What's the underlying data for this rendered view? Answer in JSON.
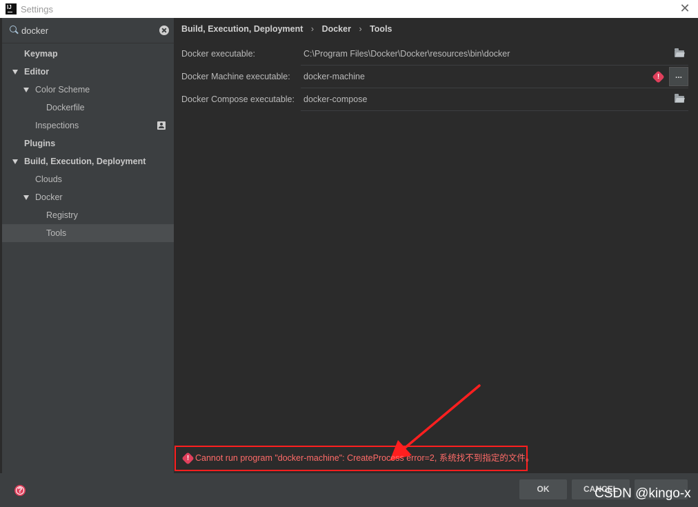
{
  "window": {
    "title": "Settings"
  },
  "search": {
    "value": "docker"
  },
  "sidebar": {
    "items": [
      {
        "label": "Keymap"
      },
      {
        "label": "Editor"
      },
      {
        "label": "Color Scheme"
      },
      {
        "label": "Dockerfile"
      },
      {
        "label": "Inspections"
      },
      {
        "label": "Plugins"
      },
      {
        "label": "Build, Execution, Deployment"
      },
      {
        "label": "Clouds"
      },
      {
        "label": "Docker"
      },
      {
        "label": "Registry"
      },
      {
        "label": "Tools"
      }
    ],
    "selected": "Tools"
  },
  "breadcrumb": [
    "Build, Execution, Deployment",
    "Docker",
    "Tools"
  ],
  "breadcrumb_separator": "›",
  "fields": [
    {
      "label": "Docker executable:",
      "value": "C:\\Program Files\\Docker\\Docker\\resources\\bin\\docker"
    },
    {
      "label": "Docker Machine executable:",
      "value": "docker-machine",
      "browse_label": "..."
    },
    {
      "label": "Docker Compose executable:",
      "value": "docker-compose"
    }
  ],
  "error": {
    "message": "Cannot run program \"docker-machine\": CreateProcess error=2, 系统找不到指定的文件。",
    "badge": "!"
  },
  "buttons": {
    "ok": "OK",
    "cancel": "CANCEL",
    "apply": ""
  },
  "help_glyph": "?",
  "watermark": "CSDN @kingo-x",
  "colors": {
    "background": "#2b2b2b",
    "sidebar": "#3c3f41",
    "selection": "#4b4e50",
    "error_text": "#ff6b68",
    "error_badge": "#e0405c",
    "annotation_red": "#ff1f1f"
  }
}
